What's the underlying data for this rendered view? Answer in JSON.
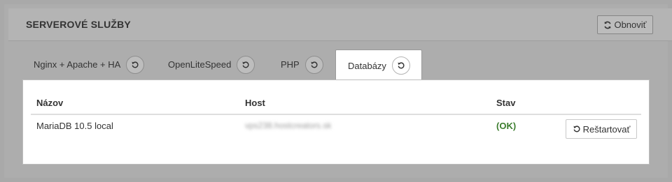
{
  "header": {
    "title": "SERVEROVÉ SLUŽBY",
    "refresh_label": "Obnoviť"
  },
  "tabs": [
    {
      "label": "Nginx + Apache + HA",
      "active": false
    },
    {
      "label": "OpenLiteSpeed",
      "active": false
    },
    {
      "label": "PHP",
      "active": false
    },
    {
      "label": "Databázy",
      "active": true
    }
  ],
  "table": {
    "columns": [
      "Názov",
      "Host",
      "Stav"
    ],
    "rows": [
      {
        "name": "MariaDB 10.5 local",
        "host": "vps238.hostcreators.sk",
        "status": "(OK)",
        "action": "Reštartovať"
      }
    ]
  },
  "colors": {
    "status_ok": "#3c7d2e",
    "background": "#adadad",
    "panel": "#ffffff"
  },
  "icons": {
    "refresh": "refresh-icon",
    "restart": "restart-icon"
  }
}
